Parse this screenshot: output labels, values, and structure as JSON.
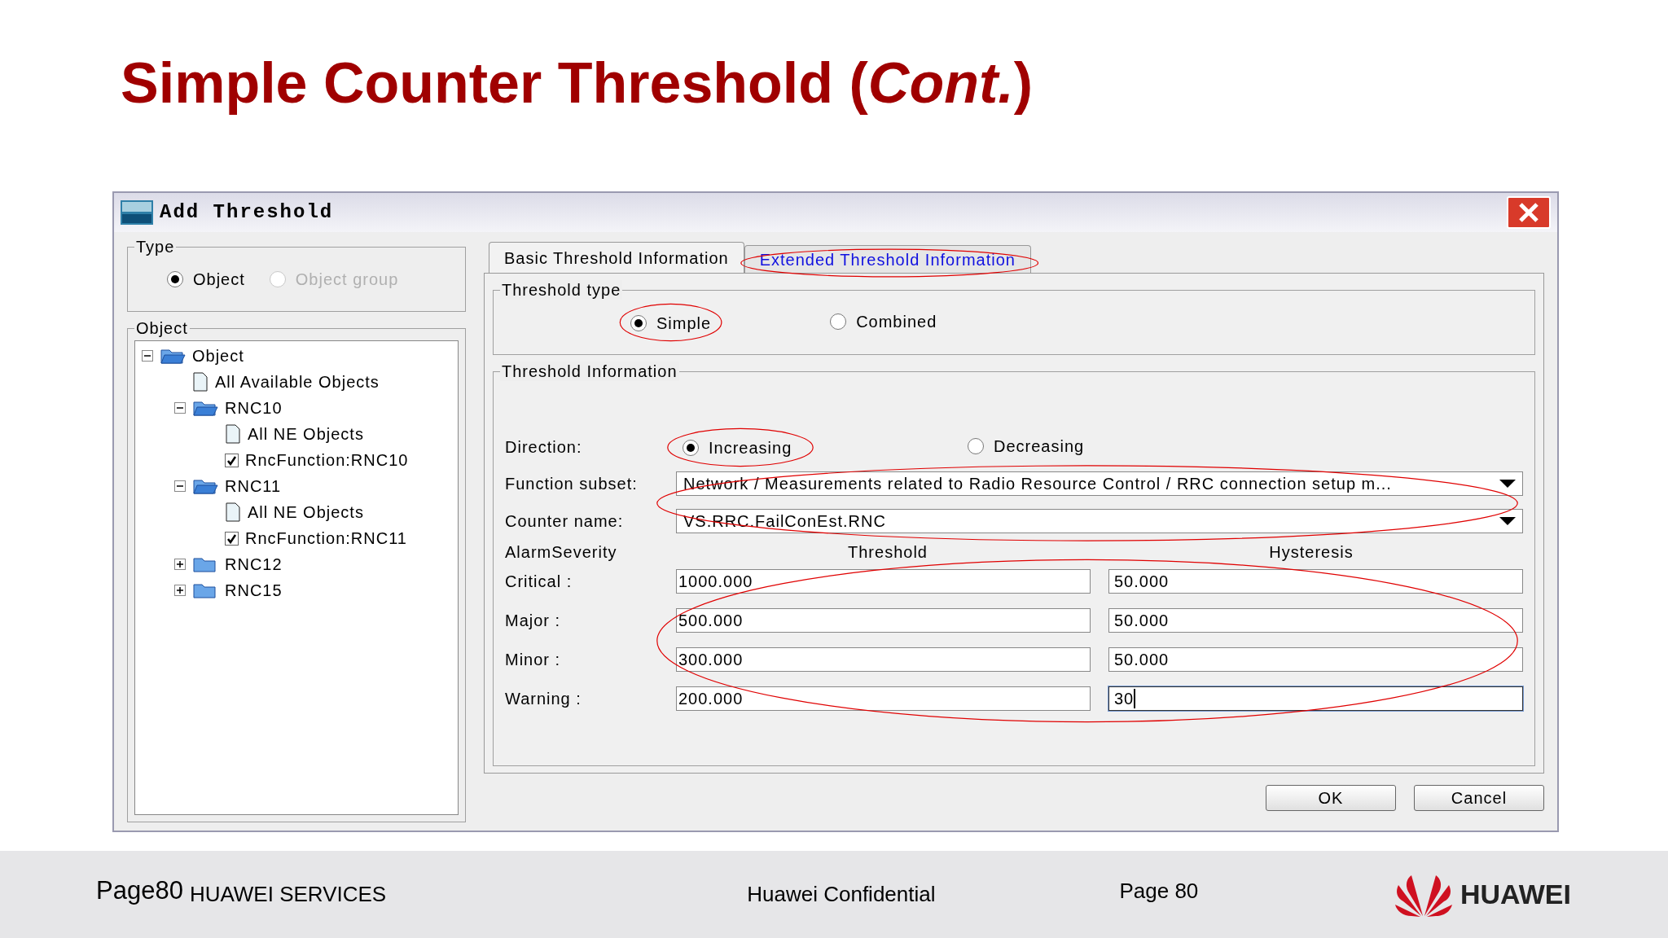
{
  "slide": {
    "title": "Simple Counter Threshold (*Cont.*)"
  },
  "dialog": {
    "title": "Add Threshold",
    "type_group": {
      "label": "Type",
      "options": [
        {
          "label": "Object",
          "selected": true,
          "disabled": false
        },
        {
          "label": "Object group",
          "selected": false,
          "disabled": true
        }
      ]
    },
    "object_group": {
      "label": "Object",
      "tree": [
        {
          "label": "Object",
          "kind": "folder",
          "expanded": true,
          "children": [
            {
              "label": "All Available Objects",
              "kind": "document"
            },
            {
              "label": "RNC10",
              "kind": "folder",
              "expanded": true,
              "children": [
                {
                  "label": "All NE Objects",
                  "kind": "document"
                },
                {
                  "label": "RncFunction:RNC10",
                  "kind": "checkbox",
                  "checked": true
                }
              ]
            },
            {
              "label": "RNC11",
              "kind": "folder",
              "expanded": true,
              "children": [
                {
                  "label": "All NE Objects",
                  "kind": "document"
                },
                {
                  "label": "RncFunction:RNC11",
                  "kind": "checkbox",
                  "checked": true
                }
              ]
            },
            {
              "label": "RNC12",
              "kind": "folder",
              "expanded": false
            },
            {
              "label": "RNC15",
              "kind": "folder",
              "expanded": false
            }
          ]
        }
      ]
    },
    "tabs": [
      {
        "label": "Basic Threshold Information",
        "selected": true,
        "circled": false
      },
      {
        "label": "Extended Threshold Information",
        "selected": false,
        "circled": true
      }
    ],
    "threshold_type": {
      "label": "Threshold type",
      "options": [
        {
          "label": "Simple",
          "selected": true,
          "circled": true
        },
        {
          "label": "Combined",
          "selected": false,
          "circled": false
        }
      ]
    },
    "threshold_info": {
      "label": "Threshold Information",
      "direction": {
        "label": "Direction:",
        "options": [
          {
            "label": "Increasing",
            "selected": true,
            "circled": true
          },
          {
            "label": "Decreasing",
            "selected": false,
            "circled": false
          }
        ]
      },
      "selectors": {
        "circled": true,
        "items": [
          {
            "label": "Function subset:",
            "value": "Network / Measurements related to Radio Resource Control / RRC connection setup m..."
          },
          {
            "label": "Counter name:",
            "value": "VS.RRC.FailConEst.RNC"
          }
        ]
      },
      "severity": {
        "circled": true,
        "columns": [
          "AlarmSeverity",
          "Threshold",
          "Hysteresis"
        ],
        "rows": [
          {
            "label": "Critical :",
            "threshold": "1000.000",
            "hysteresis": "50.000",
            "focused": false
          },
          {
            "label": "Major :",
            "threshold": "500.000",
            "hysteresis": "50.000",
            "focused": false
          },
          {
            "label": "Minor :",
            "threshold": "300.000",
            "hysteresis": "50.000",
            "focused": false
          },
          {
            "label": "Warning :",
            "threshold": "200.000",
            "hysteresis": "30",
            "focused": true
          }
        ]
      }
    },
    "buttons": [
      "OK",
      "Cancel"
    ]
  },
  "footer": {
    "overlay": "Page80",
    "left": "HUAWEI SERVICES",
    "center": "Huawei Confidential",
    "page": "Page 80",
    "brand": "HUAWEI"
  }
}
